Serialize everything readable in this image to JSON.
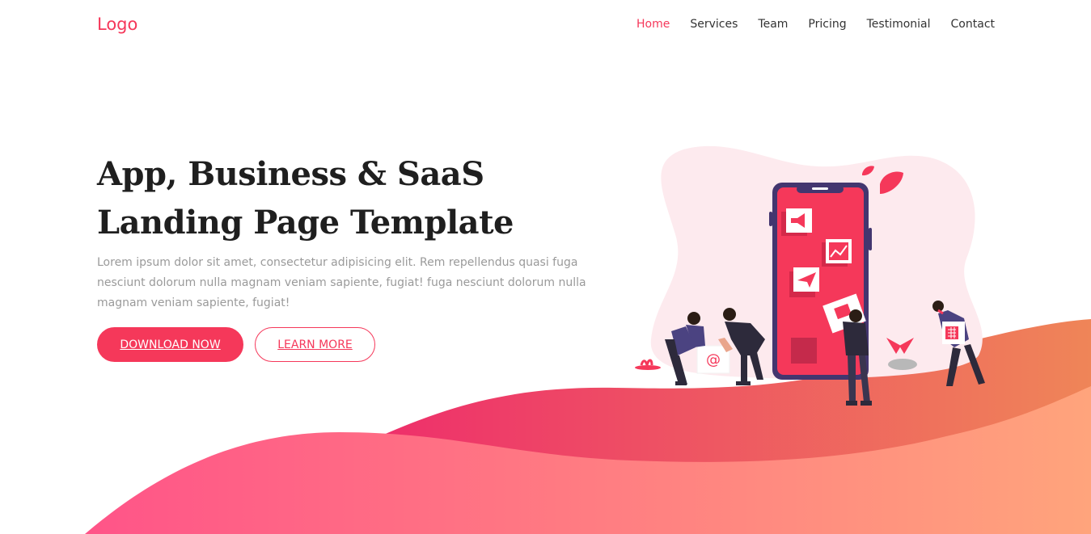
{
  "nav": {
    "logo": "Logo",
    "links": [
      {
        "label": "Home",
        "active": true
      },
      {
        "label": "Services",
        "active": false
      },
      {
        "label": "Team",
        "active": false
      },
      {
        "label": "Pricing",
        "active": false
      },
      {
        "label": "Testimonial",
        "active": false
      },
      {
        "label": "Contact",
        "active": false
      }
    ]
  },
  "hero": {
    "title_line1": "App, Business & SaaS",
    "title_line2": "Landing Page Template",
    "description": "Lorem ipsum dolor sit amet, consectetur adipisicing elit. Rem repellendus quasi fuga nesciunt dolorum nulla magnam veniam sapiente, fugiat! fuga nesciunt dolorum nulla magnam veniam sapiente, fugiat!",
    "primary_button": "DOWNLOAD NOW",
    "secondary_button": "LEARN MORE"
  },
  "illustration": {
    "email_glyph": "@"
  },
  "colors": {
    "accent": "#f5385a",
    "heading": "#1f1f1f",
    "body_text": "#9a9a9a",
    "nav_text": "#333333",
    "blob": "#fdeaee",
    "phone_frame": "#43366f",
    "wave_front_left": "#ff5488",
    "wave_front_right": "#ffa47c",
    "wave_back_left": "#ee2f6b",
    "wave_back_right": "#ef8558"
  }
}
